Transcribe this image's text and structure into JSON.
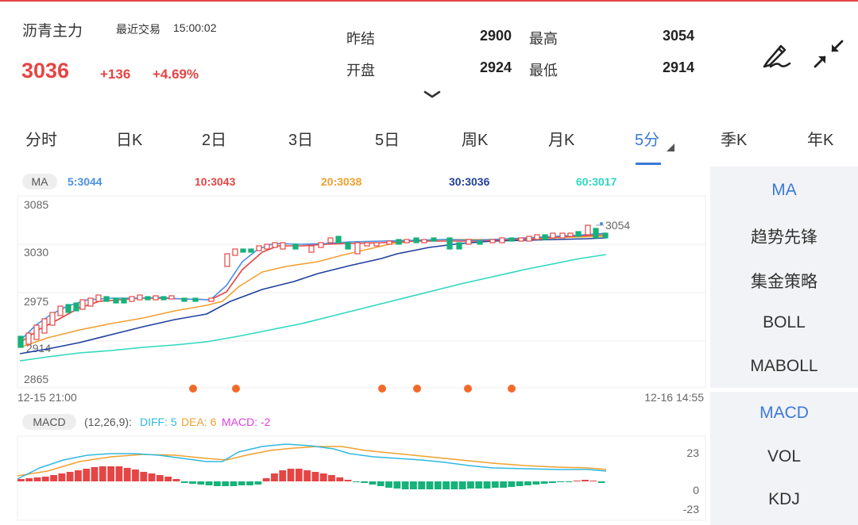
{
  "header": {
    "contract_name": "沥青主力",
    "recent_trade_label": "最近交易",
    "recent_trade_time": "15:00:02",
    "last_price": "3036",
    "change": "+136",
    "change_pct": "+4.69%",
    "stats": [
      {
        "label": "昨结",
        "value": "2900"
      },
      {
        "label": "最高",
        "value": "3054"
      },
      {
        "label": "开盘",
        "value": "2924"
      },
      {
        "label": "最低",
        "value": "2914"
      }
    ],
    "icons": {
      "expand": "chevron-down-icon",
      "draw": "pen-icon",
      "shrink": "shrink-icon"
    }
  },
  "tabs": [
    "分时",
    "日K",
    "2日",
    "3日",
    "5日",
    "周K",
    "月K",
    "5分",
    "季K",
    "年K"
  ],
  "active_tab": "5分",
  "ma_bar": {
    "badge": "MA",
    "items": [
      {
        "text": "5:3044",
        "color": "#4a90e2"
      },
      {
        "text": "10:3043",
        "color": "#e64545"
      },
      {
        "text": "20:3038",
        "color": "#f0a030"
      },
      {
        "text": "30:3036",
        "color": "#1f3f9c"
      },
      {
        "text": "60:3017",
        "color": "#2ed8c0"
      }
    ]
  },
  "price_axis": {
    "labels": [
      "3085",
      "3030",
      "2975",
      "2865"
    ],
    "high_label": "3054",
    "low_label": "2914"
  },
  "time_axis": {
    "start": "12-15 21:00",
    "end": "12-16 14:55"
  },
  "macd_bar": {
    "badge": "MACD",
    "params": "(12,26,9):",
    "diff": "DIFF: 5",
    "dea": "DEA: 6",
    "macd": "MACD: -2",
    "colors": {
      "diff": "#30b8e0",
      "dea": "#f0a030",
      "macd": "#e040e0"
    }
  },
  "macd_axis": {
    "labels": [
      "23",
      "0",
      "-23"
    ]
  },
  "panel": {
    "top_items": [
      "MA",
      "趋势先锋",
      "集金策略",
      "BOLL",
      "MABOLL"
    ],
    "bottom_items": [
      "MACD",
      "VOL",
      "KDJ"
    ],
    "active_top": "MA",
    "active_bottom": "MACD"
  },
  "colors": {
    "up": "#e64545",
    "down": "#16b27a",
    "accent": "#3b7ad8",
    "signal": "#f26a2a"
  }
}
